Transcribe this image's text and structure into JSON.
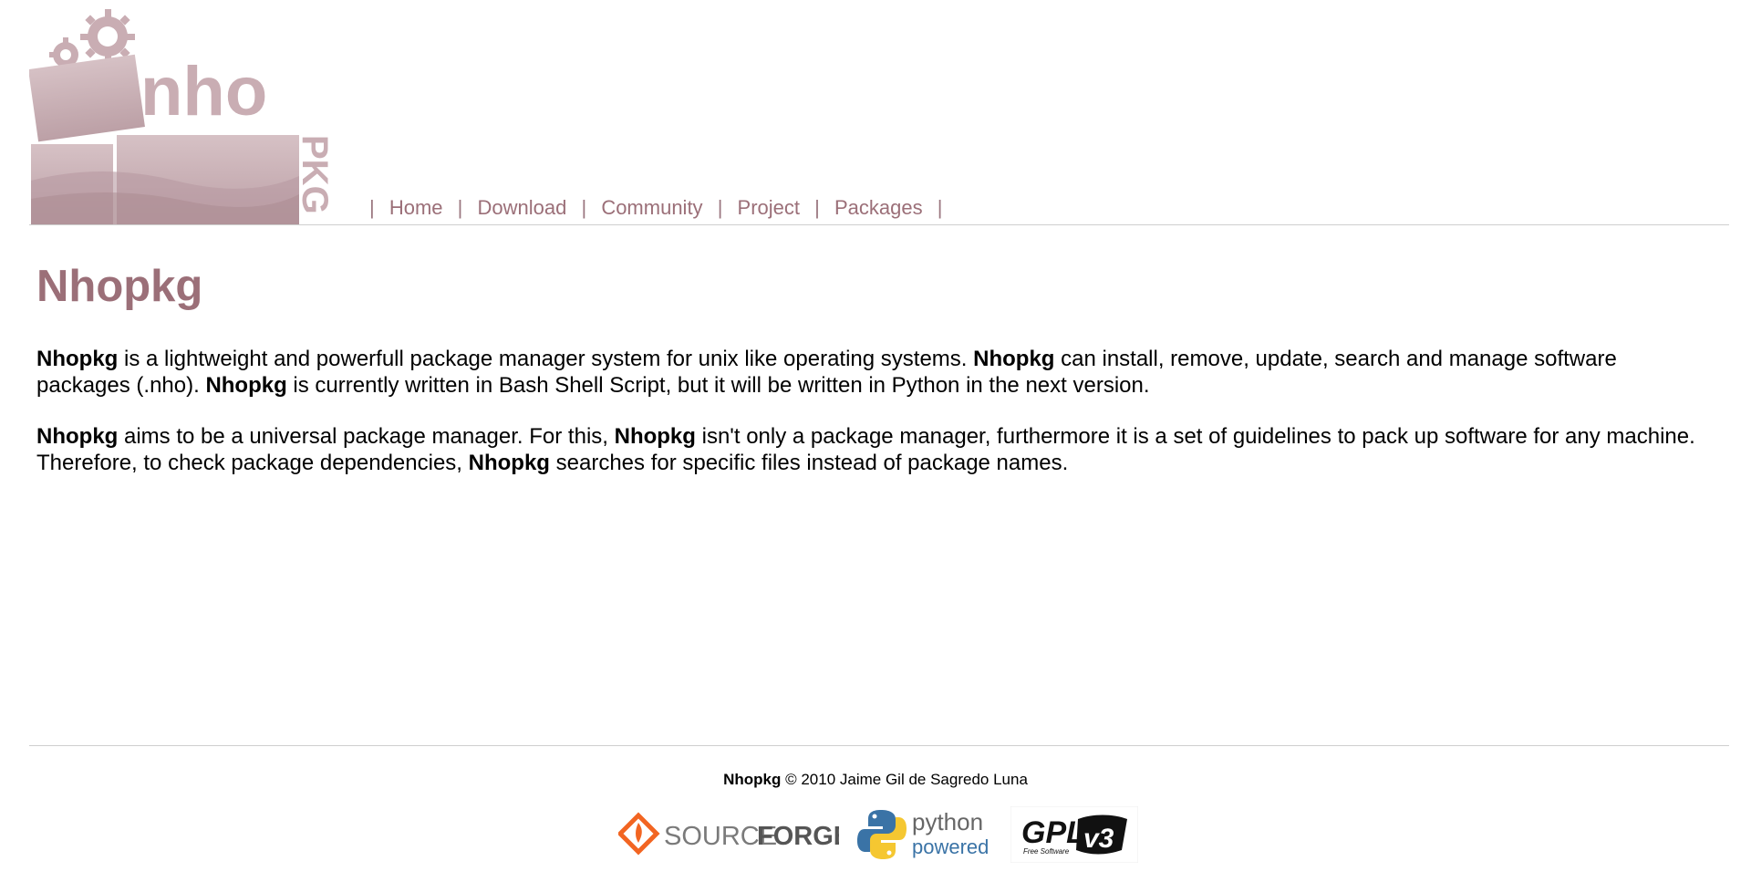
{
  "logo": {
    "text_main": "nho",
    "text_side": "PKG",
    "color": "#c9adb3"
  },
  "nav": {
    "separator": "|",
    "items": [
      {
        "label": "Home"
      },
      {
        "label": "Download"
      },
      {
        "label": "Community"
      },
      {
        "label": "Project"
      },
      {
        "label": "Packages"
      }
    ]
  },
  "main": {
    "title": "Nhopkg",
    "paragraph1": [
      {
        "text": "Nhopkg",
        "bold": true
      },
      {
        "text": " is a lightweight and powerfull package manager system for unix like operating systems. ",
        "bold": false
      },
      {
        "text": "Nhopkg",
        "bold": true
      },
      {
        "text": " can install, remove, update, search and manage software packages (.nho). ",
        "bold": false
      },
      {
        "text": "Nhopkg",
        "bold": true
      },
      {
        "text": " is currently written in Bash Shell Script, but it will be written in Python in the next version.",
        "bold": false
      }
    ],
    "paragraph2": [
      {
        "text": "Nhopkg",
        "bold": true
      },
      {
        "text": " aims to be a universal package manager. For this, ",
        "bold": false
      },
      {
        "text": "Nhopkg",
        "bold": true
      },
      {
        "text": " isn't only a package manager, furthermore it is a set of guidelines to pack up software for any machine. Therefore, to check package dependencies, ",
        "bold": false
      },
      {
        "text": "Nhopkg",
        "bold": true
      },
      {
        "text": " searches for specific files instead of package names.",
        "bold": false
      }
    ]
  },
  "footer": {
    "brand": "Nhopkg",
    "copyright": "© 2010 Jaime Gil de Sagredo Luna",
    "badges": {
      "sourceforge": {
        "word1": "SOURCE",
        "word2": "FORGE"
      },
      "python": {
        "word1": "python",
        "word2": "powered"
      },
      "gpl": {
        "word1": "GPL",
        "word2": "v3",
        "caption": "Free Software"
      }
    }
  },
  "colors": {
    "accent": "#9b6f78",
    "separator": "#cfcfcf"
  }
}
